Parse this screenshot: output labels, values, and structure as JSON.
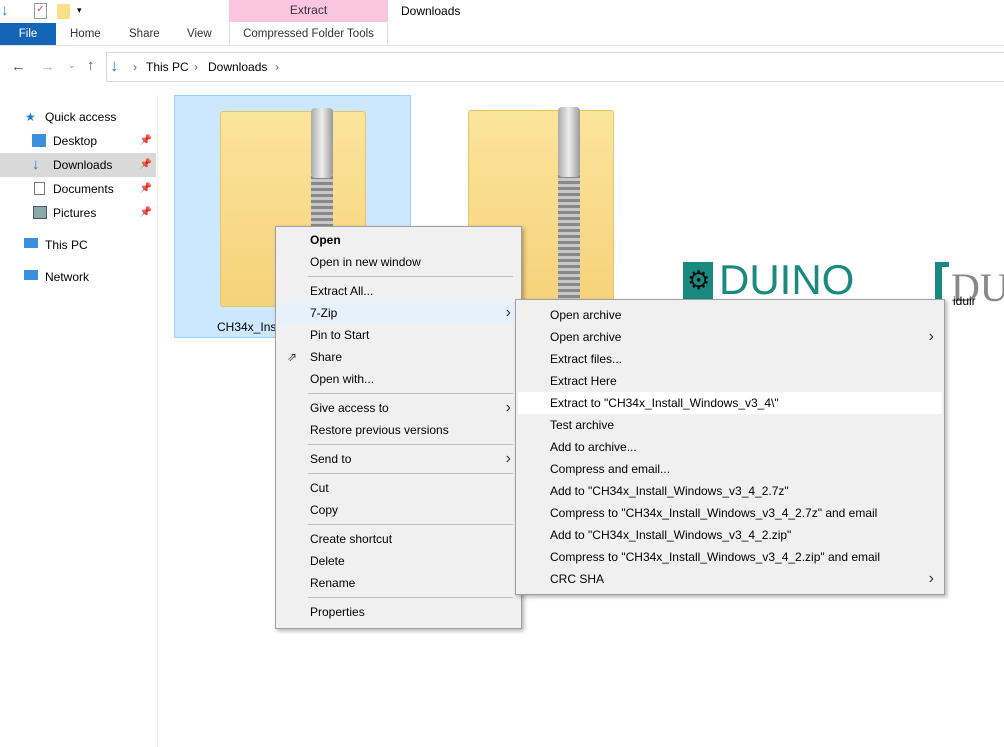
{
  "ribbon": {
    "contextual_tab": "Extract",
    "window_title": "Downloads",
    "tabs": [
      "File",
      "Home",
      "Share",
      "View"
    ],
    "contextual_subtab": "Compressed Folder Tools"
  },
  "address": {
    "crumbs": [
      "This PC",
      "Downloads"
    ]
  },
  "sidebar": {
    "items": [
      {
        "label": "Quick access",
        "icon": "star-icon"
      },
      {
        "label": "Desktop",
        "icon": "desktop-icon",
        "pinned": true
      },
      {
        "label": "Downloads",
        "icon": "download-icon",
        "pinned": true,
        "selected": true
      },
      {
        "label": "Documents",
        "icon": "documents-icon",
        "pinned": true
      },
      {
        "label": "Pictures",
        "icon": "pictures-icon",
        "pinned": true
      },
      {
        "label": "This PC",
        "icon": "computer-icon"
      },
      {
        "label": "Network",
        "icon": "network-icon"
      }
    ]
  },
  "files": [
    {
      "name": "CH34x_Inst",
      "selected": true
    },
    {
      "name": ""
    },
    {
      "name": ""
    },
    {
      "name": "iduir"
    }
  ],
  "context_menu": {
    "items": [
      {
        "label": "Open",
        "bold": true
      },
      {
        "label": "Open in new window"
      },
      {
        "sep": true
      },
      {
        "label": "Extract All..."
      },
      {
        "label": "7-Zip",
        "submenu": true,
        "hover": true
      },
      {
        "label": "Pin to Start"
      },
      {
        "label": "Share",
        "icon": "share-icon"
      },
      {
        "label": "Open with..."
      },
      {
        "sep": true
      },
      {
        "label": "Give access to",
        "submenu": true
      },
      {
        "label": "Restore previous versions"
      },
      {
        "sep": true
      },
      {
        "label": "Send to",
        "submenu": true
      },
      {
        "sep": true
      },
      {
        "label": "Cut"
      },
      {
        "label": "Copy"
      },
      {
        "sep": true
      },
      {
        "label": "Create shortcut"
      },
      {
        "label": "Delete"
      },
      {
        "label": "Rename"
      },
      {
        "sep": true
      },
      {
        "label": "Properties"
      }
    ]
  },
  "zip_menu": {
    "items": [
      {
        "label": "Open archive"
      },
      {
        "label": "Open archive",
        "submenu": true
      },
      {
        "label": "Extract files..."
      },
      {
        "label": "Extract Here"
      },
      {
        "label": "Extract to \"CH34x_Install_Windows_v3_4\\\"",
        "hover": true
      },
      {
        "label": "Test archive"
      },
      {
        "label": "Add to archive..."
      },
      {
        "label": "Compress and email..."
      },
      {
        "label": "Add to \"CH34x_Install_Windows_v3_4_2.7z\""
      },
      {
        "label": "Compress to \"CH34x_Install_Windows_v3_4_2.7z\" and email"
      },
      {
        "label": "Add to \"CH34x_Install_Windows_v3_4_2.zip\""
      },
      {
        "label": "Compress to \"CH34x_Install_Windows_v3_4_2.zip\" and email"
      },
      {
        "label": "CRC SHA",
        "submenu": true
      }
    ]
  },
  "logos": {
    "text1": "DUINO",
    "text2": "DU"
  }
}
